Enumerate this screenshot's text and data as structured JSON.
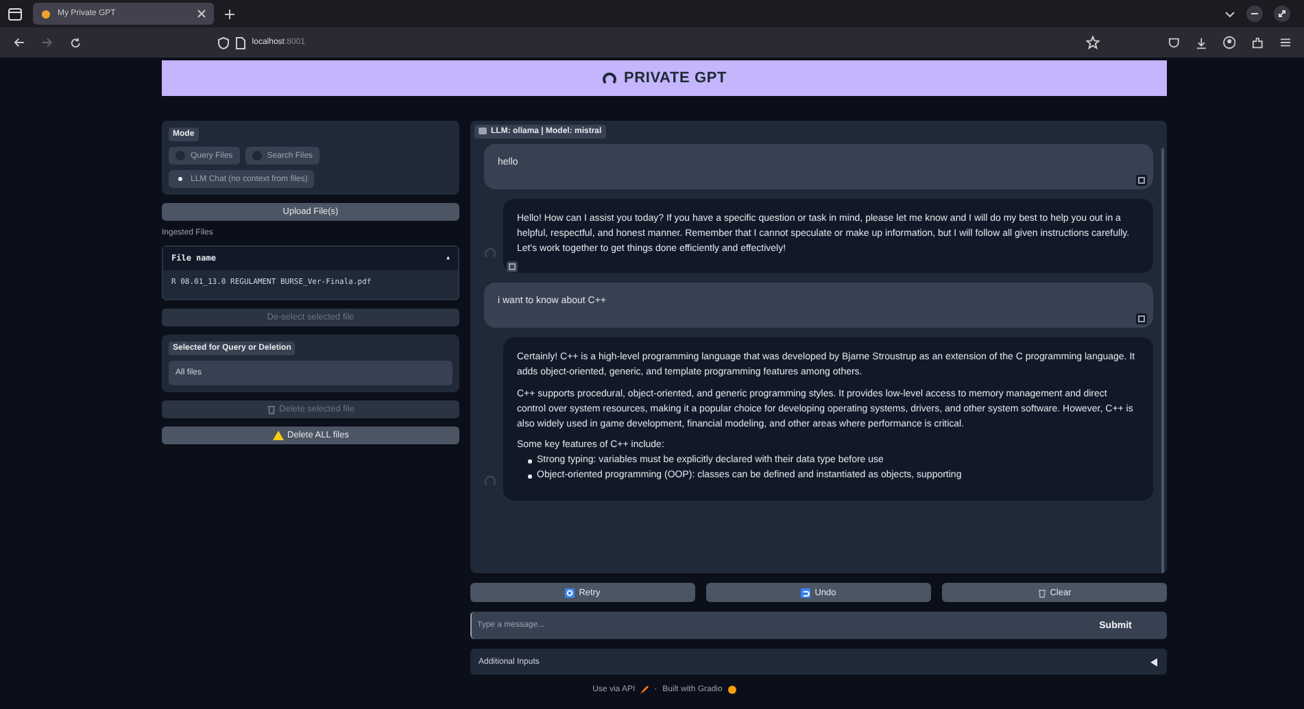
{
  "browser": {
    "tabs": [
      {
        "title": "My Private GPT",
        "selected": true
      }
    ],
    "address": {
      "host": "localhost",
      "port": ":8001"
    }
  },
  "header": {
    "title": "PRIVATE GPT"
  },
  "sidebar": {
    "mode_label": "Mode",
    "modes": [
      {
        "label": "Query Files",
        "selected": false
      },
      {
        "label": "Search Files",
        "selected": false
      },
      {
        "label": "LLM Chat (no context from files)",
        "selected": true
      }
    ],
    "upload_button": {
      "label": "Upload File(s)",
      "disabled": false
    },
    "ingested_label": "Ingested Files",
    "table": {
      "columns": [
        "File name"
      ],
      "sort_icon": "▲",
      "rows": [
        "R 08.01_13.0 REGULAMENT BURSE_Ver-Finala.pdf"
      ]
    },
    "deselect_button": {
      "label": "De-select selected file",
      "disabled": true
    },
    "selected_label": "Selected for Query or Deletion",
    "selected_value": "All files",
    "delete_selected_button": {
      "label": "Delete selected file",
      "disabled": true
    },
    "delete_all_button": {
      "label": "Delete ALL files",
      "disabled": false
    }
  },
  "chat": {
    "label": "LLM: ollama | Model: mistral",
    "messages": [
      {
        "kind": "user",
        "paragraphs": [
          "hello"
        ]
      },
      {
        "kind": "bot",
        "paragraphs": [
          "Hello! How can I assist you today? If you have a specific question or task in mind, please let me know and I will do my best to help you out in a helpful, respectful, and honest manner. Remember that I cannot speculate or make up information, but I will follow all given instructions carefully. Let's work together to get things done efficiently and effectively!"
        ]
      },
      {
        "kind": "user",
        "paragraphs": [
          "i want to know about C++"
        ]
      },
      {
        "kind": "bot",
        "paragraphs": [
          "Certainly! C++ is a high-level programming language that was developed by Bjarne Stroustrup as an extension of the C programming language. It adds object-oriented, generic, and template programming features among others.",
          "C++ supports procedural, object-oriented, and generic programming styles. It provides low-level access to memory management and direct control over system resources, making it a popular choice for developing operating systems, drivers, and other system software. However, C++ is also widely used in game development, financial modeling, and other areas where performance is critical.",
          "Some key features of C++ include:"
        ],
        "bullets": [
          "Strong typing: variables must be explicitly declared with their data type before use",
          "Object-oriented programming (OOP): classes can be defined and instantiated as objects, supporting"
        ]
      }
    ]
  },
  "actions": [
    {
      "label": "Retry",
      "kind": "retry"
    },
    {
      "label": "Undo",
      "kind": "undo"
    },
    {
      "label": "Clear",
      "kind": "clear"
    }
  ],
  "input": {
    "placeholder": "Type a message...",
    "submit": "Submit"
  },
  "additional_inputs": {
    "label": "Additional Inputs",
    "expanded": false
  },
  "footer": {
    "api": "Use via API",
    "separator": "·",
    "built": "Built with Gradio"
  }
}
